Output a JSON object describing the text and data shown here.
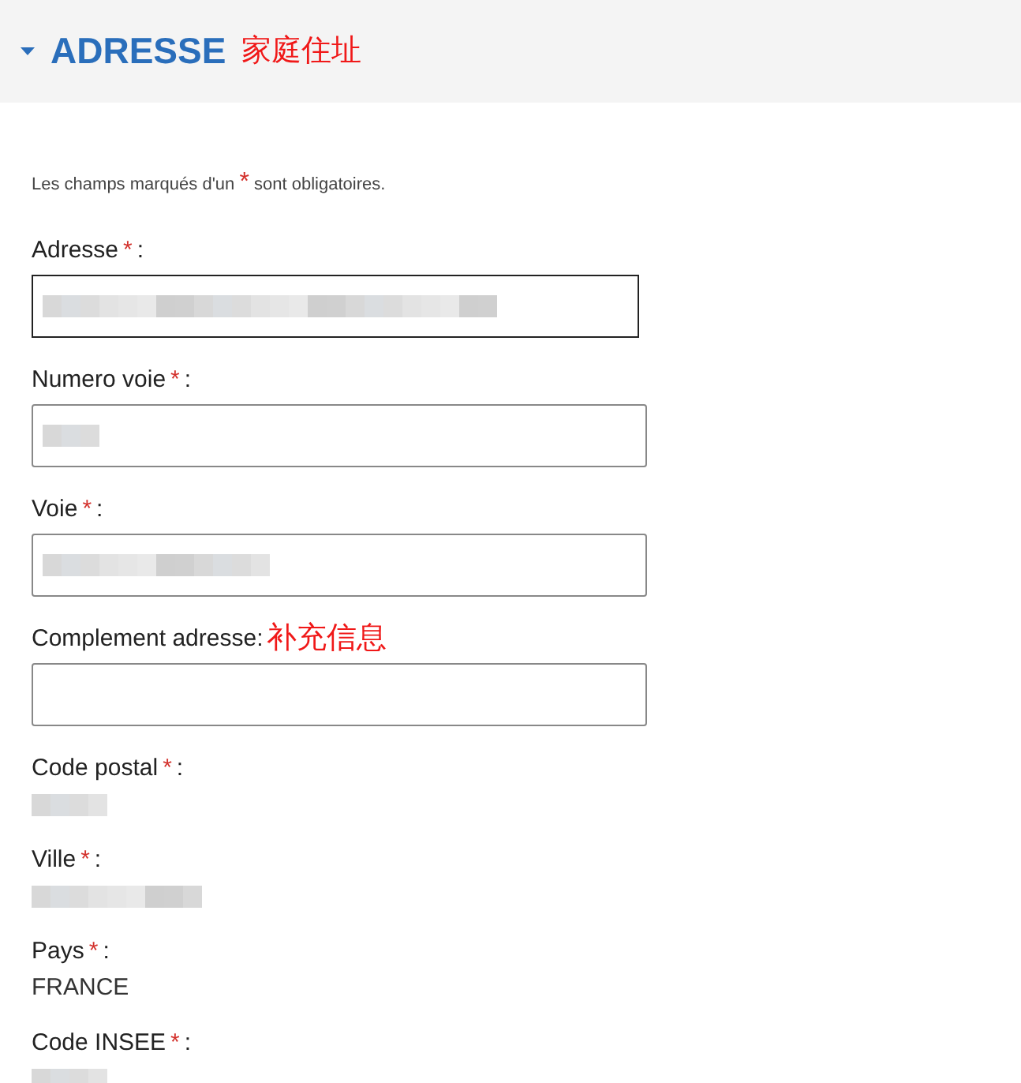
{
  "section": {
    "title": "ADRESSE",
    "annotation": "家庭住址",
    "expanded": true
  },
  "notice": {
    "before": "Les champs marqués d'un",
    "mark": "*",
    "after": "sont obligatoires."
  },
  "fields": [
    {
      "kind": "input",
      "label": "Adresse",
      "mark": "*",
      "colon": ":",
      "focused": true,
      "redacted": true
    },
    {
      "kind": "input",
      "label": "Numero voie",
      "mark": "*",
      "colon": ":",
      "focused": false,
      "redacted": true
    },
    {
      "kind": "input",
      "label": "Voie",
      "mark": "*",
      "colon": ":",
      "focused": false,
      "redacted": true
    },
    {
      "kind": "input",
      "label": "Complement adresse",
      "colon": ":",
      "annotation": "补充信息",
      "focused": false
    },
    {
      "kind": "text",
      "label": "Code postal",
      "mark": "*",
      "colon": ":",
      "redacted": true
    },
    {
      "kind": "text",
      "label": "Ville",
      "mark": "*",
      "colon": ":",
      "redacted": true
    },
    {
      "kind": "text",
      "label": "Pays",
      "mark": "*",
      "colon": ":",
      "value": "FRANCE"
    },
    {
      "kind": "text",
      "label": "Code INSEE",
      "mark": "*",
      "colon": ":",
      "redacted": true
    }
  ]
}
